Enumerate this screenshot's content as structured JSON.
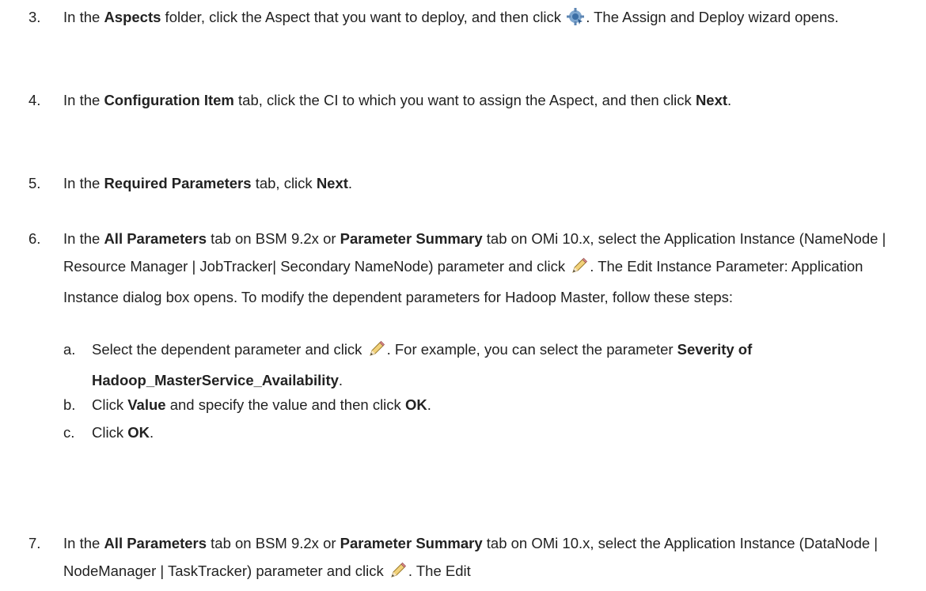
{
  "steps": [
    {
      "num": "3.",
      "parts": [
        {
          "t": "In the "
        },
        {
          "b": "Aspects"
        },
        {
          "t": " folder, click the Aspect that you want to deploy, and then click "
        },
        {
          "icon": "deploy-icon"
        },
        {
          "t": ". The Assign and Deploy wizard opens."
        }
      ]
    },
    {
      "num": "4.",
      "parts": [
        {
          "t": "In the "
        },
        {
          "b": "Configuration Item"
        },
        {
          "t": " tab, click the CI to which you want to assign the Aspect, and then click "
        },
        {
          "b": "Next"
        },
        {
          "t": "."
        }
      ]
    },
    {
      "num": "5.",
      "parts": [
        {
          "t": "In the "
        },
        {
          "b": "Required Parameters"
        },
        {
          "t": " tab, click "
        },
        {
          "b": "Next"
        },
        {
          "t": "."
        }
      ]
    },
    {
      "num": "6.",
      "parts": [
        {
          "t": "In the "
        },
        {
          "b": "All Parameters"
        },
        {
          "t": " tab on BSM 9.2x or "
        },
        {
          "b": "Parameter Summary"
        },
        {
          "t": " tab on OMi 10.x, select the Application Instance (NameNode | Resource Manager | JobTracker| Secondary NameNode) parameter and click "
        },
        {
          "icon": "edit-pencil-icon"
        },
        {
          "t": ". The Edit Instance Parameter: Application Instance dialog box opens. To modify the dependent parameters for Hadoop Master, follow these steps:"
        }
      ]
    },
    {
      "num": "a.",
      "parts": [
        {
          "t": "Select the dependent parameter and click "
        },
        {
          "icon": "edit-pencil-icon"
        },
        {
          "t": ". For example, you can select the parameter "
        },
        {
          "b": "Severity of Hadoop_MasterService_Availability"
        },
        {
          "t": "."
        }
      ]
    },
    {
      "num": "b.",
      "parts": [
        {
          "t": "Click "
        },
        {
          "b": "Value"
        },
        {
          "t": " and specify the value and then click "
        },
        {
          "b": "OK"
        },
        {
          "t": "."
        }
      ]
    },
    {
      "num": "c.",
      "parts": [
        {
          "t": "Click "
        },
        {
          "b": "OK"
        },
        {
          "t": "."
        }
      ]
    },
    {
      "num": "7.",
      "parts": [
        {
          "t": "In the "
        },
        {
          "b": "All Parameters"
        },
        {
          "t": " tab on BSM 9.2x or "
        },
        {
          "b": "Parameter Summary"
        },
        {
          "t": " tab on OMi 10.x, select the Application Instance (DataNode | NodeManager | TaskTracker) parameter and click "
        },
        {
          "icon": "edit-pencil-icon"
        },
        {
          "t": ". The Edit"
        }
      ]
    }
  ]
}
